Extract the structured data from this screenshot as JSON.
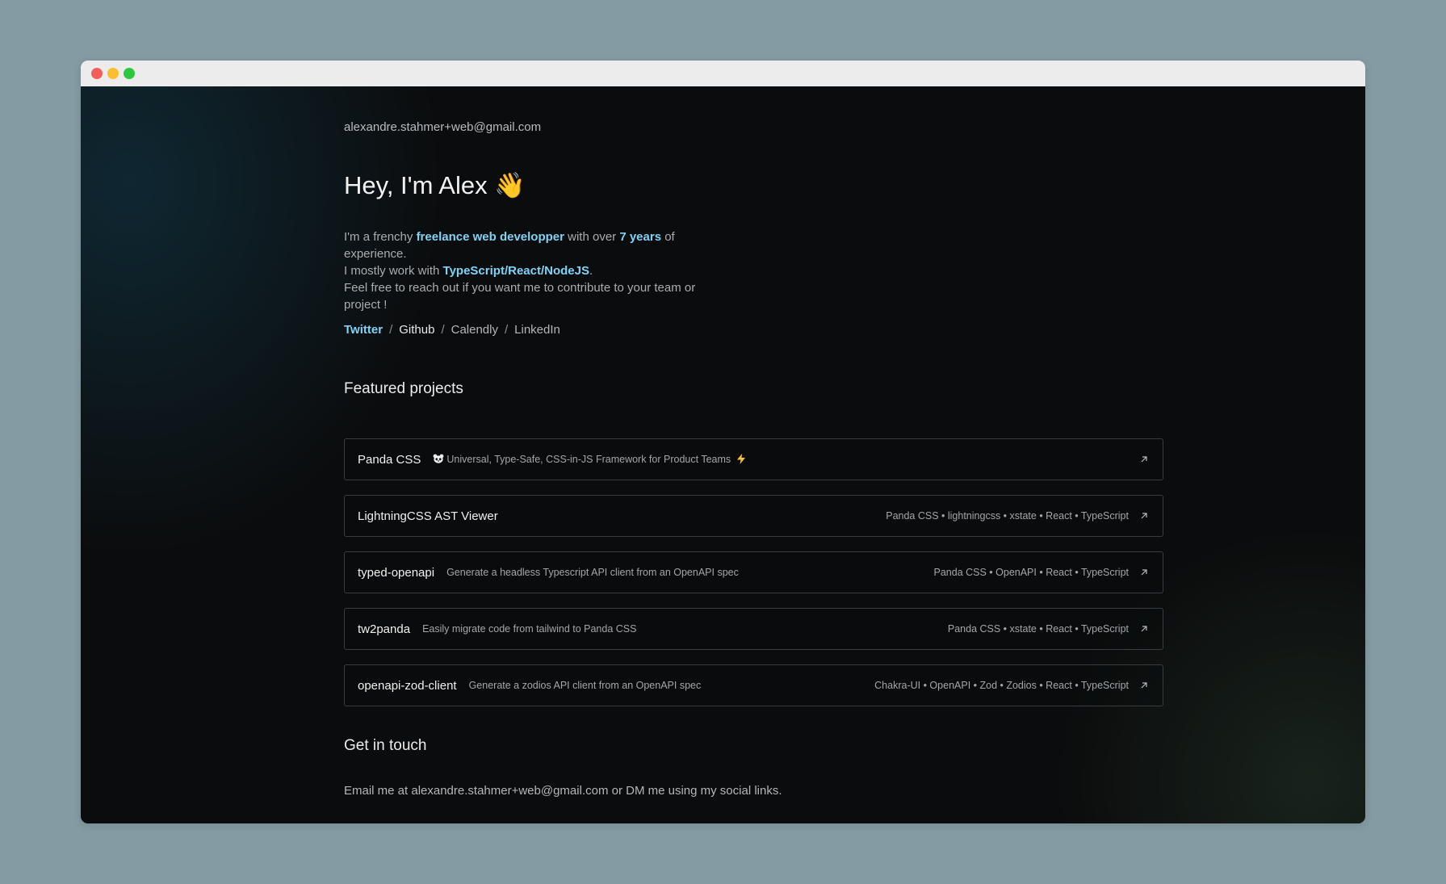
{
  "window": {
    "controls": [
      "close",
      "minimize",
      "maximize"
    ]
  },
  "header": {
    "email": "alexandre.stahmer+web@gmail.com"
  },
  "hero": {
    "title": "Hey, I'm Alex",
    "emoji": "👋"
  },
  "intro": {
    "line1_pre": "I'm a frenchy ",
    "line1_hl1": "freelance web developper",
    "line1_mid": " with over ",
    "line1_hl2": "7 years",
    "line1_post": " of experience.",
    "line2_pre": "I mostly work with ",
    "line2_hl": "TypeScript/React/NodeJS",
    "line2_post": ".",
    "line3": "Feel free to reach out if you want me to contribute to your team or project !"
  },
  "social": {
    "links": [
      "Twitter",
      "Github",
      "Calendly",
      "LinkedIn"
    ],
    "separator": "/"
  },
  "projects": {
    "title": "Featured projects",
    "items": [
      {
        "name": "Panda CSS",
        "desc_icon": "panda-icon",
        "description": "Universal, Type-Safe, CSS-in-JS Framework for Product Teams",
        "desc_suffix_icon": "lightning-icon",
        "tags": ""
      },
      {
        "name": "LightningCSS AST Viewer",
        "description": "",
        "tags": "Panda CSS • lightningcss • xstate • React • TypeScript"
      },
      {
        "name": "typed-openapi",
        "description": "Generate a headless Typescript API client from an OpenAPI spec",
        "tags": "Panda CSS • OpenAPI • React • TypeScript"
      },
      {
        "name": "tw2panda",
        "description": "Easily migrate code from tailwind to Panda CSS",
        "tags": "Panda CSS • xstate • React • TypeScript"
      },
      {
        "name": "openapi-zod-client",
        "description": "Generate a zodios API client from an OpenAPI spec",
        "tags": "Chakra-UI • OpenAPI • Zod • Zodios • React • TypeScript"
      }
    ]
  },
  "contact": {
    "title": "Get in touch",
    "text": "Email me at alexandre.stahmer+web@gmail.com or DM me using my social links."
  },
  "colors": {
    "background_outer": "#849ba3",
    "content_bg": "#0b0c0d",
    "accent": "#7fd3f5",
    "border": "#3a3d40"
  }
}
